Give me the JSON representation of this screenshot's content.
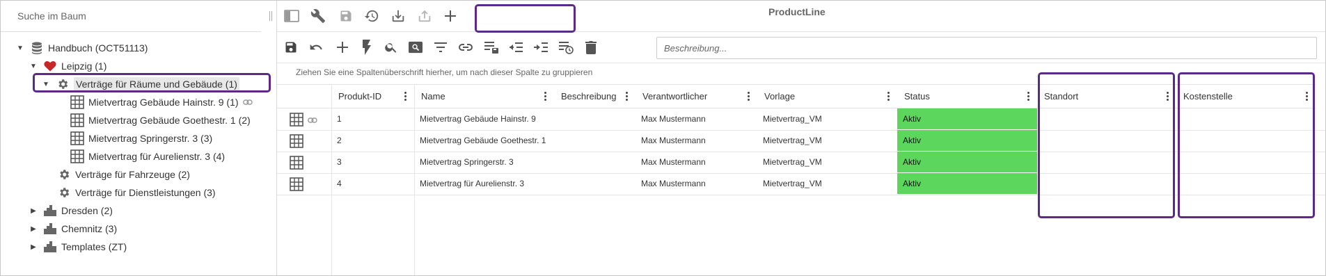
{
  "tree": {
    "search_placeholder": "Suche im Baum",
    "nodes": [
      {
        "label": "Handbuch (OCT51113)",
        "icon": "database-icon"
      },
      {
        "label": "Leipzig (1)",
        "icon": "heart-icon"
      },
      {
        "label": "Verträge für Räume und Gebäude (1)",
        "icon": "gear-icon"
      },
      {
        "label": "Mietvertrag Gebäude Hainstr. 9 (1)",
        "icon": "table-icon"
      },
      {
        "label": "Mietvertrag Gebäude Goethestr. 1 (2)",
        "icon": "table-icon"
      },
      {
        "label": "Mietvertrag Springerstr. 3 (3)",
        "icon": "table-icon"
      },
      {
        "label": "Mietvertrag für Aurelienstr. 3 (4)",
        "icon": "table-icon"
      },
      {
        "label": "Verträge für Fahrzeuge (2)",
        "icon": "gear-icon"
      },
      {
        "label": "Verträge für Dienstleistungen (3)",
        "icon": "gear-icon"
      },
      {
        "label": "Dresden (2)",
        "icon": "building-icon"
      },
      {
        "label": "Chemnitz (3)",
        "icon": "building-icon"
      },
      {
        "label": "Templates (ZT)",
        "icon": "building-icon"
      }
    ]
  },
  "toolbar": {
    "active_tab": "ProductLine",
    "description_placeholder": "Beschreibung..."
  },
  "grid": {
    "group_hint": "Ziehen Sie eine Spaltenüberschrift hierher, um nach dieser Spalte zu gruppieren",
    "columns": [
      "Produkt-ID",
      "Name",
      "Beschreibung",
      "Verantwortlicher",
      "Vorlage",
      "Status",
      "Standort",
      "Kostenstelle"
    ],
    "rows": [
      {
        "id": "1",
        "name": "Mietvertrag Gebäude Hainstr. 9",
        "beschreibung": "",
        "verantwortlicher": "Max Mustermann",
        "vorlage": "Mietvertrag_VM",
        "status": "Aktiv",
        "standort": "",
        "kostenstelle": ""
      },
      {
        "id": "2",
        "name": "Mietvertrag Gebäude Goethestr. 1",
        "beschreibung": "",
        "verantwortlicher": "Max Mustermann",
        "vorlage": "Mietvertrag_VM",
        "status": "Aktiv",
        "standort": "",
        "kostenstelle": ""
      },
      {
        "id": "3",
        "name": "Mietvertrag Springerstr. 3",
        "beschreibung": "",
        "verantwortlicher": "Max Mustermann",
        "vorlage": "Mietvertrag_VM",
        "status": "Aktiv",
        "standort": "",
        "kostenstelle": ""
      },
      {
        "id": "4",
        "name": "Mietvertrag für Aurelienstr. 3",
        "beschreibung": "",
        "verantwortlicher": "Max Mustermann",
        "vorlage": "Mietvertrag_VM",
        "status": "Aktiv",
        "standort": "",
        "kostenstelle": ""
      }
    ]
  },
  "colors": {
    "highlight": "#5b2a86",
    "status_active": "#5cd65c",
    "heart": "#c62828"
  }
}
